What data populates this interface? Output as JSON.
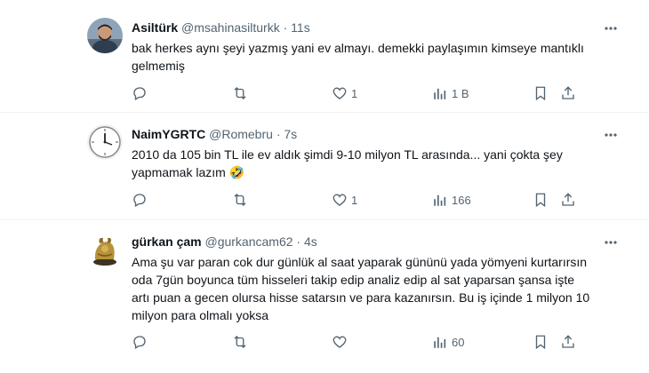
{
  "tweets": [
    {
      "name": "Asiltürk",
      "handle": "@msahinasilturkk",
      "separator": "·",
      "time": "11s",
      "text": "bak herkes aynı şeyi yazmış yani ev almayı. demekki paylaşımın kimseye mantıklı gelmemiş",
      "reply_count": "",
      "retweet_count": "",
      "like_count": "1",
      "view_count": "1 B"
    },
    {
      "name": "NaimYGRTC",
      "handle": "@Romebru",
      "separator": "·",
      "time": "7s",
      "text": "2010 da 105 bin TL ile ev aldık şimdi 9-10 milyon TL arasında... yani çokta şey yapmamak lazım 🤣",
      "reply_count": "",
      "retweet_count": "",
      "like_count": "1",
      "view_count": "166"
    },
    {
      "name": "gürkan çam",
      "handle": "@gurkancam62",
      "separator": "·",
      "time": "4s",
      "text": "Ama şu var paran cok dur günlük al saat yaparak gününü yada yömyeni kurtarırsın oda 7gün boyunca tüm hisseleri takip edip analiz edip al sat yaparsan şansa işte artı puan a gecen olursa hisse satarsın ve para kazanırsın. Bu iş içinde 1 milyon 10 milyon para olmalı yoksa",
      "reply_count": "",
      "retweet_count": "",
      "like_count": "",
      "view_count": "60"
    }
  ],
  "colors": {
    "text_primary": "#0f1419",
    "text_secondary": "#536471",
    "divider": "#eff3f4"
  },
  "icons": [
    "more-icon",
    "reply-icon",
    "retweet-icon",
    "like-icon",
    "views-icon",
    "bookmark-icon",
    "share-icon"
  ]
}
